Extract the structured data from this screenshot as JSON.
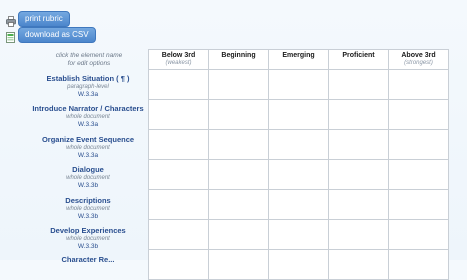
{
  "actions": {
    "print_label": "print rubric",
    "csv_label": "download as CSV"
  },
  "hint": {
    "line1": "click the element name",
    "line2": "for edit options"
  },
  "columns": [
    {
      "label": "Below 3rd",
      "sub": "(weakest)"
    },
    {
      "label": "Beginning",
      "sub": ""
    },
    {
      "label": "Emerging",
      "sub": ""
    },
    {
      "label": "Proficient",
      "sub": ""
    },
    {
      "label": "Above 3rd",
      "sub": "(strongest)"
    }
  ],
  "rows": [
    {
      "title": "Establish Situation ( ¶ )",
      "scope": "paragraph-level",
      "standard": "W.3.3a"
    },
    {
      "title": "Introduce Narrator / Characters",
      "scope": "whole document",
      "standard": "W.3.3a"
    },
    {
      "title": "Organize Event Sequence",
      "scope": "whole document",
      "standard": "W.3.3a"
    },
    {
      "title": "Dialogue",
      "scope": "whole document",
      "standard": "W.3.3b"
    },
    {
      "title": "Descriptions",
      "scope": "whole document",
      "standard": "W.3.3b"
    },
    {
      "title": "Develop Experiences",
      "scope": "whole document",
      "standard": "W.3.3b"
    },
    {
      "title": "Character Re...",
      "scope": "",
      "standard": ""
    }
  ]
}
